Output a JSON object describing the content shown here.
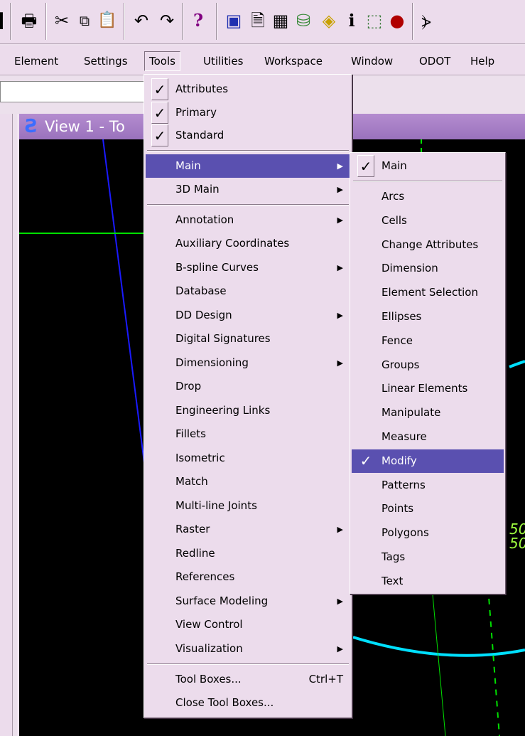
{
  "toolbar": {
    "icons": [
      "grip-icon",
      "print-icon",
      "cut-icon",
      "copy-icon",
      "paste-icon",
      "undo-icon",
      "redo-icon",
      "help-icon",
      "view-icon",
      "document-icon",
      "calculator-icon",
      "database-icon",
      "layers-icon",
      "info-icon",
      "fence-icon",
      "record-icon",
      "more-icon"
    ]
  },
  "menubar": {
    "items": [
      "Element",
      "Settings",
      "Tools",
      "Utilities",
      "Workspace",
      "Window",
      "ODOT",
      "Help"
    ]
  },
  "view": {
    "title": "View 1 - To"
  },
  "tools_menu": {
    "top_items": [
      {
        "label": "Attributes",
        "checked": true
      },
      {
        "label": "Primary",
        "checked": true
      },
      {
        "label": "Standard",
        "checked": true
      }
    ],
    "middle_items": [
      {
        "label": "Main",
        "submenu": true,
        "selected": true
      },
      {
        "label": "3D Main",
        "submenu": true
      }
    ],
    "items": [
      {
        "label": "Annotation",
        "submenu": true
      },
      {
        "label": "Auxiliary Coordinates"
      },
      {
        "label": "B-spline Curves",
        "submenu": true
      },
      {
        "label": "Database"
      },
      {
        "label": "DD Design",
        "submenu": true
      },
      {
        "label": "Digital Signatures"
      },
      {
        "label": "Dimensioning",
        "submenu": true
      },
      {
        "label": "Drop"
      },
      {
        "label": "Engineering Links"
      },
      {
        "label": "Fillets"
      },
      {
        "label": "Isometric"
      },
      {
        "label": "Match"
      },
      {
        "label": "Multi-line Joints"
      },
      {
        "label": "Raster",
        "submenu": true
      },
      {
        "label": "Redline"
      },
      {
        "label": "References"
      },
      {
        "label": "Surface Modeling",
        "submenu": true
      },
      {
        "label": "View Control"
      },
      {
        "label": "Visualization",
        "submenu": true
      }
    ],
    "bottom_items": [
      {
        "label": "Tool Boxes...",
        "shortcut": "Ctrl+T"
      },
      {
        "label": "Close Tool Boxes..."
      }
    ]
  },
  "main_submenu": {
    "header": {
      "label": "Main",
      "checked": true
    },
    "items": [
      {
        "label": "Arcs"
      },
      {
        "label": "Cells"
      },
      {
        "label": "Change Attributes"
      },
      {
        "label": "Dimension"
      },
      {
        "label": "Element Selection"
      },
      {
        "label": "Ellipses"
      },
      {
        "label": "Fence"
      },
      {
        "label": "Groups"
      },
      {
        "label": "Linear Elements"
      },
      {
        "label": "Manipulate"
      },
      {
        "label": "Measure"
      },
      {
        "label": "Modify",
        "checked": true,
        "selected": true
      },
      {
        "label": "Patterns"
      },
      {
        "label": "Points"
      },
      {
        "label": "Polygons"
      },
      {
        "label": "Tags"
      },
      {
        "label": "Text"
      }
    ]
  },
  "cad_text": [
    "50",
    "50"
  ]
}
